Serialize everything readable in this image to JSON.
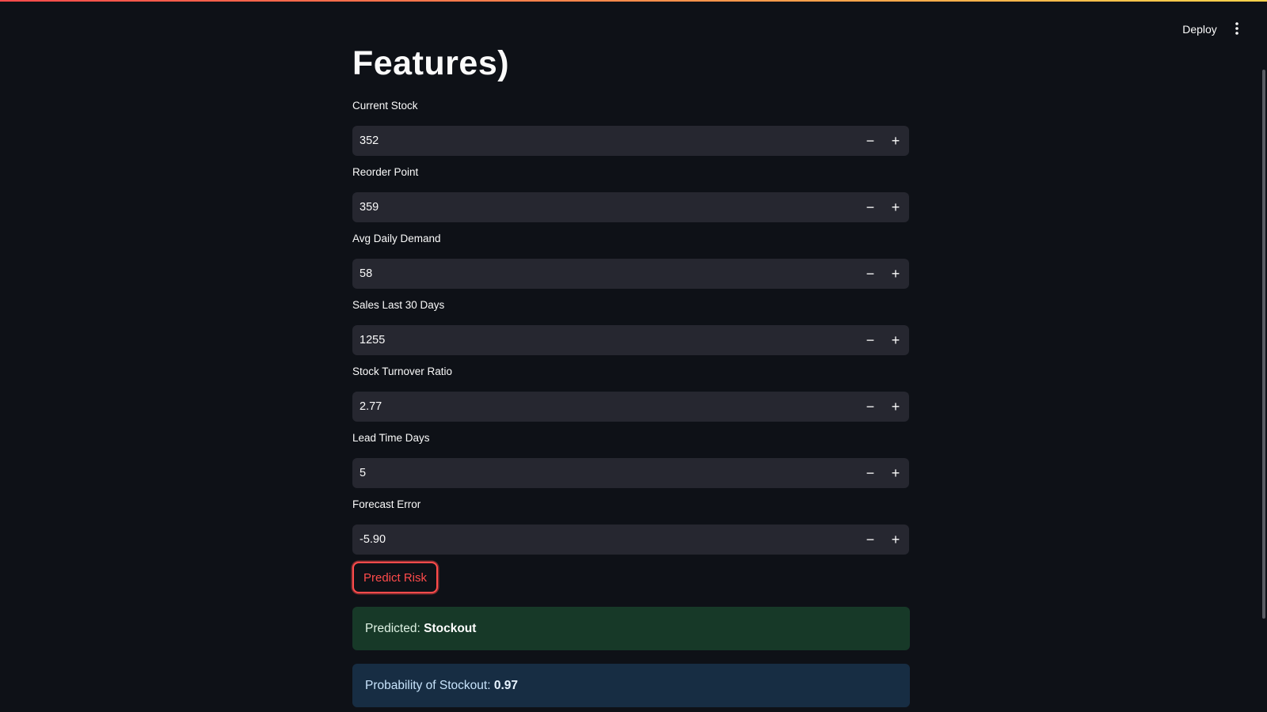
{
  "header": {
    "deploy_label": "Deploy",
    "menu_icon": "more-vertical-icon"
  },
  "page": {
    "title": "Features)"
  },
  "fields": [
    {
      "label": "Current Stock",
      "value": "352"
    },
    {
      "label": "Reorder Point",
      "value": "359"
    },
    {
      "label": "Avg Daily Demand",
      "value": "58"
    },
    {
      "label": "Sales Last 30 Days",
      "value": "1255"
    },
    {
      "label": "Stock Turnover Ratio",
      "value": "2.77"
    },
    {
      "label": "Lead Time Days",
      "value": "5"
    },
    {
      "label": "Forecast Error",
      "value": "-5.90"
    }
  ],
  "stepper": {
    "minus": "−",
    "plus": "+"
  },
  "predict_button": {
    "label": "Predict Risk",
    "accent_color": "#ff4b4b"
  },
  "result": {
    "prediction_prefix": "Predicted: ",
    "prediction_value": "Stockout",
    "probability_prefix": "Probability of Stockout: ",
    "probability_value": "0.97"
  }
}
